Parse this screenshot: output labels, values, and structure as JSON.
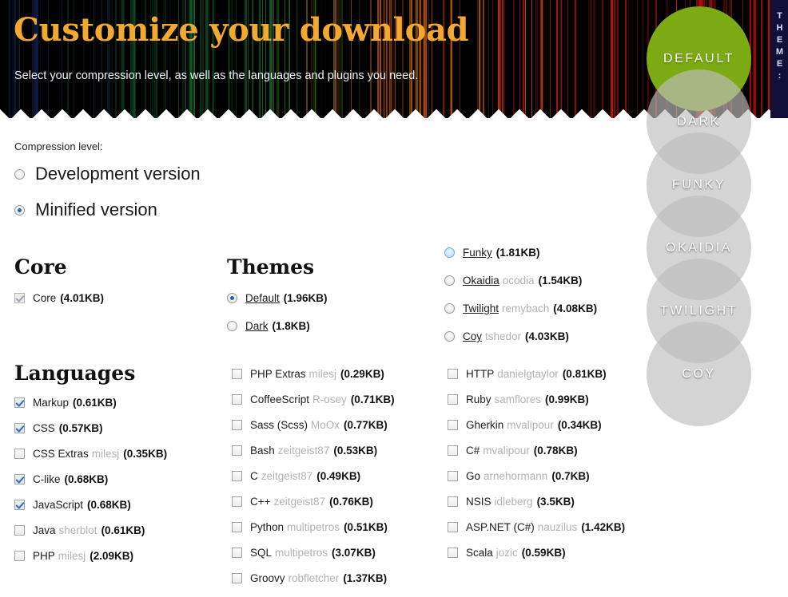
{
  "header": {
    "title": "Customize your download",
    "subtitle": "Select your compression level, as well as the languages and plugins you need.",
    "theme_tab_label": "THEME:",
    "title_color": "#f3a830",
    "subtitle_color": "#eef3fb",
    "background_color": "#000000"
  },
  "theme_circles": {
    "active_color": "#7cab13",
    "items": [
      {
        "label": "DEFAULT",
        "active": true
      },
      {
        "label": "DARK",
        "active": false
      },
      {
        "label": "FUNKY",
        "active": false
      },
      {
        "label": "OKAIDIA",
        "active": false
      },
      {
        "label": "TWILIGHT",
        "active": false
      },
      {
        "label": "COY",
        "active": false
      }
    ]
  },
  "compression": {
    "label": "Compression level:",
    "options": [
      {
        "label": "Development version",
        "checked": false
      },
      {
        "label": "Minified version",
        "checked": true
      }
    ]
  },
  "core": {
    "heading": "Core",
    "items": [
      {
        "name": "Core",
        "author": "",
        "size": "(4.01KB)",
        "checked": true,
        "disabled": true
      }
    ]
  },
  "themes": {
    "heading": "Themes",
    "column1": [
      {
        "name": "Default",
        "author": "",
        "size": "(1.96KB)",
        "checked": true,
        "hover": false
      },
      {
        "name": "Dark",
        "author": "",
        "size": "(1.8KB)",
        "checked": false,
        "hover": false
      }
    ],
    "column2": [
      {
        "name": "Funky",
        "author": "",
        "size": "(1.81KB)",
        "checked": false,
        "hover": true
      },
      {
        "name": "Okaidia",
        "author": "ocodia",
        "size": "(1.54KB)",
        "checked": false,
        "hover": false
      },
      {
        "name": "Twilight",
        "author": "remybach",
        "size": "(4.08KB)",
        "checked": false,
        "hover": false
      },
      {
        "name": "Coy",
        "author": "tshedor",
        "size": "(4.03KB)",
        "checked": false,
        "hover": false
      }
    ]
  },
  "languages": {
    "heading": "Languages",
    "column1": [
      {
        "name": "Markup",
        "author": "",
        "size": "(0.61KB)",
        "checked": true
      },
      {
        "name": "CSS",
        "author": "",
        "size": "(0.57KB)",
        "checked": true
      },
      {
        "name": "CSS Extras",
        "author": "milesj",
        "size": "(0.35KB)",
        "checked": false
      },
      {
        "name": "C-like",
        "author": "",
        "size": "(0.68KB)",
        "checked": true
      },
      {
        "name": "JavaScript",
        "author": "",
        "size": "(0.68KB)",
        "checked": true
      },
      {
        "name": "Java",
        "author": "sherblot",
        "size": "(0.61KB)",
        "checked": false
      },
      {
        "name": "PHP",
        "author": "milesj",
        "size": "(2.09KB)",
        "checked": false
      }
    ],
    "column2": [
      {
        "name": "PHP Extras",
        "author": "milesj",
        "size": "(0.29KB)",
        "checked": false
      },
      {
        "name": "CoffeeScript",
        "author": "R-osey",
        "size": "(0.71KB)",
        "checked": false
      },
      {
        "name": "Sass (Scss)",
        "author": "MoOx",
        "size": "(0.77KB)",
        "checked": false
      },
      {
        "name": "Bash",
        "author": "zeitgeist87",
        "size": "(0.53KB)",
        "checked": false
      },
      {
        "name": "C",
        "author": "zeitgeist87",
        "size": "(0.49KB)",
        "checked": false
      },
      {
        "name": "C++",
        "author": "zeitgeist87",
        "size": "(0.76KB)",
        "checked": false
      },
      {
        "name": "Python",
        "author": "multipetros",
        "size": "(0.51KB)",
        "checked": false
      },
      {
        "name": "SQL",
        "author": "multipetros",
        "size": "(3.07KB)",
        "checked": false
      },
      {
        "name": "Groovy",
        "author": "robfletcher",
        "size": "(1.37KB)",
        "checked": false
      }
    ],
    "column3": [
      {
        "name": "HTTP",
        "author": "danielgtaylor",
        "size": "(0.81KB)",
        "checked": false
      },
      {
        "name": "Ruby",
        "author": "samflores",
        "size": "(0.99KB)",
        "checked": false
      },
      {
        "name": "Gherkin",
        "author": "mvalipour",
        "size": "(0.34KB)",
        "checked": false
      },
      {
        "name": "C#",
        "author": "mvalipour",
        "size": "(0.78KB)",
        "checked": false
      },
      {
        "name": "Go",
        "author": "arnehormann",
        "size": "(0.7KB)",
        "checked": false
      },
      {
        "name": "NSIS",
        "author": "idleberg",
        "size": "(3.5KB)",
        "checked": false
      },
      {
        "name": "ASP.NET (C#)",
        "author": "nauzilus",
        "size": "(1.42KB)",
        "checked": false
      },
      {
        "name": "Scala",
        "author": "jozic",
        "size": "(0.59KB)",
        "checked": false
      }
    ]
  }
}
